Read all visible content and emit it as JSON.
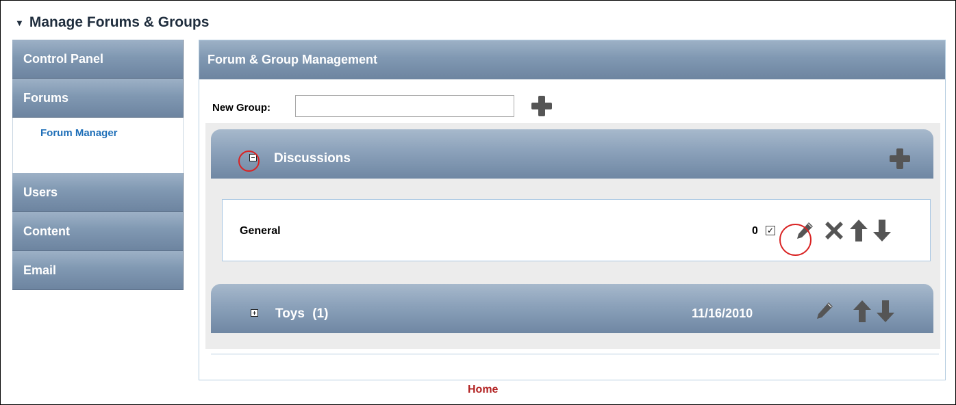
{
  "page": {
    "title": "Manage Forums & Groups"
  },
  "sidebar": {
    "items": [
      {
        "label": "Control Panel"
      },
      {
        "label": "Forums",
        "subitems": [
          {
            "label": "Forum Manager"
          }
        ]
      },
      {
        "label": "Users"
      },
      {
        "label": "Content"
      },
      {
        "label": "Email"
      }
    ]
  },
  "main": {
    "header": "Forum & Group Management",
    "new_group": {
      "label": "New Group:",
      "value": "",
      "placeholder": ""
    },
    "groups": [
      {
        "title": "Discussions",
        "expanded": true,
        "forums": [
          {
            "name": "General",
            "count": "0",
            "checked": true
          }
        ]
      },
      {
        "title": "Toys",
        "count_label": "(1)",
        "date": "11/16/2010",
        "expanded": false
      }
    ]
  },
  "footer": {
    "home_label": "Home"
  },
  "icons": {
    "add": "plus-icon",
    "edit": "pencil-icon",
    "delete": "delete-x-icon",
    "up": "arrow-up-icon",
    "down": "arrow-down-icon",
    "collapse": "minus-box-icon",
    "expand": "plus-box-icon",
    "section": "triangle-down-icon"
  },
  "colors": {
    "header_gradient_top": "#9db1c6",
    "header_gradient_bottom": "#6d84a0",
    "link_blue": "#1f6fb8",
    "home_red": "#b22222",
    "highlight_red": "#d92323",
    "icon_gray": "#555555"
  }
}
